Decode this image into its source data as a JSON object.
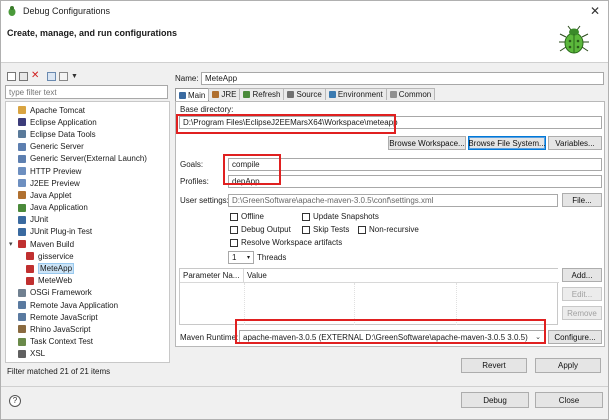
{
  "window": {
    "title": "Debug Configurations"
  },
  "header": {
    "title": "Create, manage, and run configurations"
  },
  "filter": {
    "placeholder": "type filter text"
  },
  "tree": {
    "items": [
      {
        "label": "Apache Tomcat",
        "icon": "tomcat-icon",
        "color": "#d9a441"
      },
      {
        "label": "Eclipse Application",
        "icon": "eclipse-icon",
        "color": "#3c3c7a"
      },
      {
        "label": "Eclipse Data Tools",
        "icon": "data-tools-icon",
        "color": "#5a7a9a"
      },
      {
        "label": "Generic Server",
        "icon": "server-icon",
        "color": "#5d7fb0"
      },
      {
        "label": "Generic Server(External Launch)",
        "icon": "server-icon",
        "color": "#5d7fb0"
      },
      {
        "label": "HTTP Preview",
        "icon": "http-icon",
        "color": "#6d8fc0"
      },
      {
        "label": "J2EE Preview",
        "icon": "j2ee-icon",
        "color": "#6d8fc0"
      },
      {
        "label": "Java Applet",
        "icon": "applet-icon",
        "color": "#b07030"
      },
      {
        "label": "Java Application",
        "icon": "java-app-icon",
        "color": "#4a8a3a"
      },
      {
        "label": "JUnit",
        "icon": "junit-icon",
        "color": "#3a6aa0"
      },
      {
        "label": "JUnit Plug-in Test",
        "icon": "junit-plugin-icon",
        "color": "#3a6aa0"
      },
      {
        "label": "Maven Build",
        "icon": "maven-icon",
        "color": "#c03030"
      },
      {
        "label": "gisservice",
        "icon": "maven-config-icon",
        "color": "#c03030"
      },
      {
        "label": "MeteApp",
        "icon": "maven-config-icon",
        "color": "#c03030"
      },
      {
        "label": "MeteWeb",
        "icon": "maven-config-icon",
        "color": "#c03030"
      },
      {
        "label": "OSGi Framework",
        "icon": "osgi-icon",
        "color": "#708090"
      },
      {
        "label": "Remote Java Application",
        "icon": "remote-java-icon",
        "color": "#5a7aa0"
      },
      {
        "label": "Remote JavaScript",
        "icon": "remote-js-icon",
        "color": "#5a7aa0"
      },
      {
        "label": "Rhino JavaScript",
        "icon": "rhino-icon",
        "color": "#8a6a40"
      },
      {
        "label": "Task Context Test",
        "icon": "task-icon",
        "color": "#6a8a4a"
      },
      {
        "label": "XSL",
        "icon": "xsl-icon",
        "color": "#606060"
      }
    ]
  },
  "status": {
    "text": "Filter matched 21 of 21 items"
  },
  "name": {
    "label": "Name:",
    "value": "MeteApp"
  },
  "tabs": [
    {
      "label": "Main",
      "icon": "main-tab-icon",
      "color": "#3a6aa0"
    },
    {
      "label": "JRE",
      "icon": "jre-icon",
      "color": "#b07030"
    },
    {
      "label": "Refresh",
      "icon": "refresh-icon",
      "color": "#4a8a3a"
    },
    {
      "label": "Source",
      "icon": "source-icon",
      "color": "#707070"
    },
    {
      "label": "Environment",
      "icon": "environment-icon",
      "color": "#3a7ab0"
    },
    {
      "label": "Common",
      "icon": "common-icon",
      "color": "#909090"
    }
  ],
  "main": {
    "base_dir_label": "Base directory:",
    "base_dir_value": "D:\\Program Files\\EclipseJ2EEMarsX64\\Workspace\\meteapp",
    "browse_workspace": "Browse Workspace...",
    "browse_fs": "Browse File System...",
    "variables": "Variables...",
    "goals_label": "Goals:",
    "goals_value": "compile",
    "profiles_label": "Profiles:",
    "profiles_value": "depApp",
    "user_settings_label": "User settings:",
    "user_settings_value": "D:\\GreenSoftware\\apache-maven-3.0.5\\conf\\settings.xml",
    "file_button": "File...",
    "offline": "Offline",
    "update_snapshots": "Update Snapshots",
    "debug_output": "Debug Output",
    "skip_tests": "Skip Tests",
    "non_recursive": "Non-recursive",
    "resolve_workspace": "Resolve Workspace artifacts",
    "threads_value": "1",
    "threads_label": "Threads",
    "param_col_name": "Parameter Na...",
    "param_col_value": "Value",
    "add": "Add...",
    "edit": "Edit...",
    "remove": "Remove",
    "runtime_label": "Maven Runtime:",
    "runtime_value": "apache-maven-3.0.5 (EXTERNAL D:\\GreenSoftware\\apache-maven-3.0.5 3.0.5)",
    "configure": "Configure..."
  },
  "actions": {
    "revert": "Revert",
    "apply": "Apply",
    "debug": "Debug",
    "close": "Close"
  },
  "colors": {
    "highlight_red": "#e02020",
    "selection_blue": "#cce4f7",
    "focus_blue": "#0078d7"
  }
}
